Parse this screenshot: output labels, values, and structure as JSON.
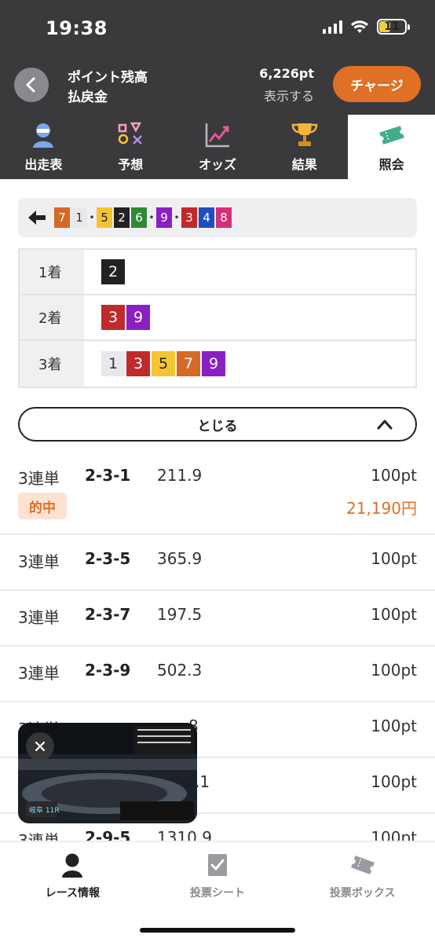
{
  "status_bar": {
    "time": "19:38",
    "battery": "11"
  },
  "header": {
    "label_points": "ポイント残高",
    "label_refund": "払戻金",
    "points_value": "6,226pt",
    "refund_value": "表示する",
    "charge_label": "チャージ"
  },
  "tabs": [
    {
      "label": "出走表",
      "icon": "racer-icon"
    },
    {
      "label": "予想",
      "icon": "shapes-icon"
    },
    {
      "label": "オッズ",
      "icon": "chart-icon"
    },
    {
      "label": "結果",
      "icon": "trophy-icon"
    },
    {
      "label": "照会",
      "icon": "ticket-icon",
      "active": true
    }
  ],
  "result_sequence": {
    "items": [
      "7",
      "1",
      "•",
      "5",
      "2",
      "6",
      "•",
      "9",
      "•",
      "3",
      "4",
      "8"
    ],
    "colors": {
      "1": "#e8e8ec",
      "2": "#222222",
      "3": "#c02a2a",
      "4": "#1f4fbf",
      "5": "#f5c531",
      "6": "#2f8a38",
      "7": "#d46a26",
      "8": "#d62f7a",
      "9": "#8a1fc4"
    }
  },
  "placements": [
    {
      "label": "1着",
      "numbers": [
        "2"
      ]
    },
    {
      "label": "2着",
      "numbers": [
        "3",
        "9"
      ]
    },
    {
      "label": "3着",
      "numbers": [
        "1",
        "3",
        "5",
        "7",
        "9"
      ]
    }
  ],
  "close_label": "とじる",
  "bets": [
    {
      "type": "3連単",
      "combo": "2-3-1",
      "odds": "211.9",
      "amount": "100pt",
      "hit": true,
      "badge": "的中",
      "payout": "21,190円"
    },
    {
      "type": "3連単",
      "combo": "2-3-5",
      "odds": "365.9",
      "amount": "100pt"
    },
    {
      "type": "3連単",
      "combo": "2-3-7",
      "odds": "197.5",
      "amount": "100pt"
    },
    {
      "type": "3連単",
      "combo": "2-3-9",
      "odds": "502.3",
      "amount": "100pt"
    },
    {
      "type": "3連単",
      "combo": "",
      "odds": "8",
      "amount": "100pt"
    },
    {
      "type": "",
      "combo": "",
      "odds": ".1",
      "amount": "100pt"
    },
    {
      "type": "3連単",
      "combo": "2-9-5",
      "odds": "1310.9",
      "amount": "100pt"
    }
  ],
  "video": {
    "close_icon": "close-icon",
    "caption": "岐阜 11R"
  },
  "bottom_nav": [
    {
      "label": "レース情報",
      "icon": "racer-icon",
      "active": true
    },
    {
      "label": "投票シート",
      "icon": "check-sheet-icon"
    },
    {
      "label": "投票ボックス",
      "icon": "ticket-box-icon"
    }
  ]
}
